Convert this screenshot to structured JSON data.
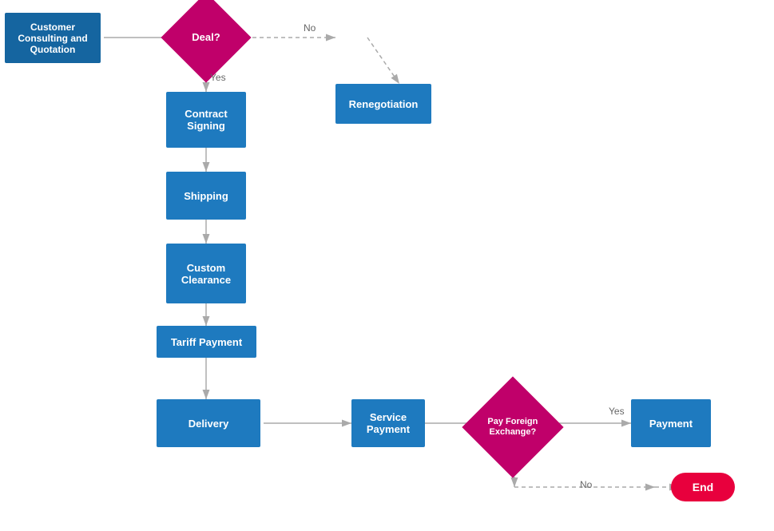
{
  "nodes": {
    "customer_consulting": {
      "label": "Customer\nConsulting and\nQuotation"
    },
    "deal": {
      "label": "Deal?"
    },
    "renegotiation": {
      "label": "Renegotiation"
    },
    "contract_signing": {
      "label": "Contract\nSigning"
    },
    "shipping": {
      "label": "Shipping"
    },
    "custom_clearance": {
      "label": "Custom\nClearance"
    },
    "tariff_payment": {
      "label": "Tariff Payment"
    },
    "delivery": {
      "label": "Delivery"
    },
    "service_payment": {
      "label": "Service\nPayment"
    },
    "pay_foreign": {
      "label": "Pay Foreign\nExchange?"
    },
    "payment": {
      "label": "Payment"
    },
    "end": {
      "label": "End"
    }
  },
  "labels": {
    "no": "No",
    "yes": "Yes",
    "yes2": "Yes",
    "no2": "No"
  }
}
